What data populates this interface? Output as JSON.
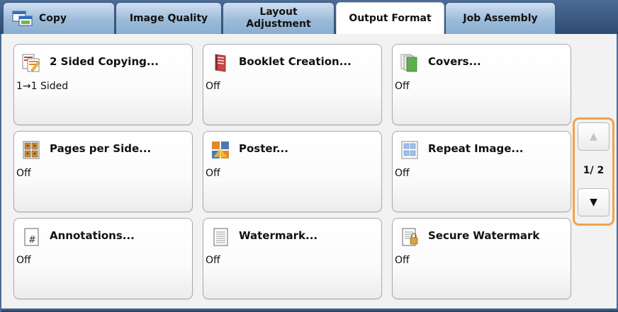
{
  "tabs": [
    {
      "label": "Copy",
      "icon": "copy-icon"
    },
    {
      "label": "Image Quality"
    },
    {
      "label_line1": "Layout",
      "label_line2": "Adjustment"
    },
    {
      "label": "Output Format",
      "active": true
    },
    {
      "label": "Job Assembly"
    }
  ],
  "features": [
    {
      "title": "2 Sided Copying...",
      "value": "1→1 Sided",
      "icon": "two-sided-icon"
    },
    {
      "title": "Booklet Creation...",
      "value": "Off",
      "icon": "booklet-icon"
    },
    {
      "title": "Covers...",
      "value": "Off",
      "icon": "covers-icon"
    },
    {
      "title": "Pages per Side...",
      "value": "Off",
      "icon": "pages-per-side-icon"
    },
    {
      "title": "Poster...",
      "value": "Off",
      "icon": "poster-icon"
    },
    {
      "title": "Repeat Image...",
      "value": "Off",
      "icon": "repeat-image-icon"
    },
    {
      "title": "Annotations...",
      "value": "Off",
      "icon": "annotations-icon"
    },
    {
      "title": "Watermark...",
      "value": "Off",
      "icon": "watermark-icon"
    },
    {
      "title": "Secure Watermark",
      "value": "Off",
      "icon": "secure-watermark-icon"
    }
  ],
  "pager": {
    "up_glyph": "▲",
    "down_glyph": "▼",
    "page_text": "1/ 2"
  },
  "colors": {
    "tab_bar": "#3d5a83",
    "pager_highlight": "#f0a24a"
  }
}
